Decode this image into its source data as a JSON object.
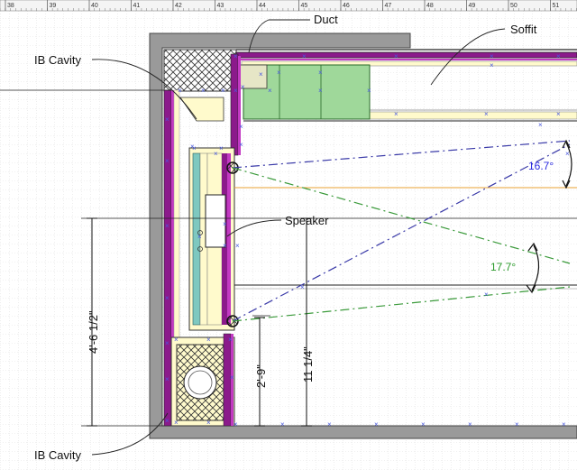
{
  "ruler": {
    "labels": [
      "38",
      "39",
      "40",
      "41",
      "42",
      "43",
      "44",
      "45",
      "46",
      "47",
      "48",
      "49",
      "50",
      "51"
    ]
  },
  "labels": {
    "duct": "Duct",
    "soffit": "Soffit",
    "ib_cavity_top": "IB Cavity",
    "speaker": "Speaker",
    "ib_cavity_bottom": "IB Cavity"
  },
  "angles": {
    "upper": "16.7°",
    "lower": "17.7°"
  },
  "dimensions": {
    "height_total": "4'-6 1/2\"",
    "height_lower": "2'-9\"",
    "height_speaker": "11 1/4\""
  },
  "colors": {
    "wall_gray": "#9a9a9a",
    "purple_band": "#8b1a8b",
    "magenta_band": "#c23ac2",
    "yellow_panel": "#fffacc",
    "green_duct": "#9fd89a",
    "blue_dash": "#3a3aa8",
    "green_dash": "#3a9a3a",
    "handle_blue": "#4a5ae0",
    "angle_blue": "#2a2ae0",
    "angle_green": "#2a9a2a"
  }
}
